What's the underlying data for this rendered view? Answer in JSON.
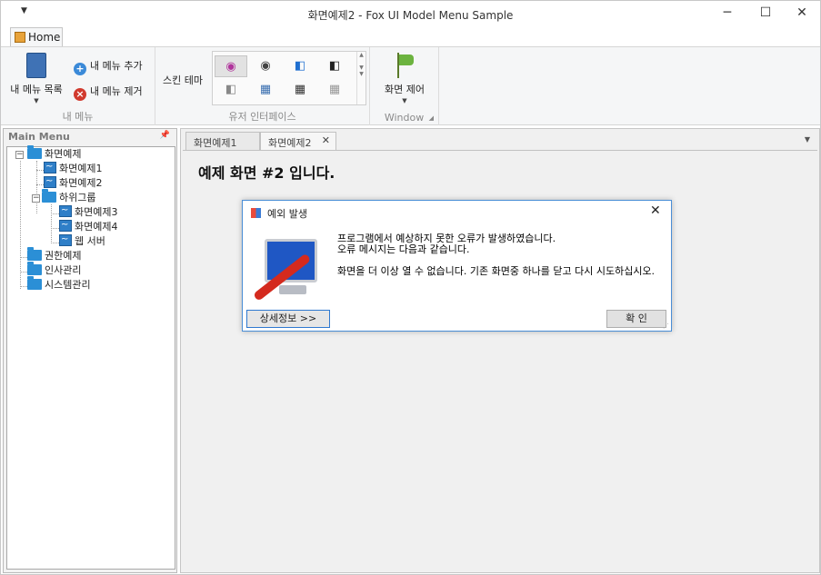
{
  "window": {
    "title": "화면예제2 - Fox UI Model Menu Sample",
    "qat_icon": "dropdown-arrow-icon",
    "min_glyph": "─",
    "max_glyph": "☐",
    "close_glyph": "✕"
  },
  "ribbon": {
    "tabs": [
      {
        "label": "Home",
        "icon": "home-icon"
      }
    ],
    "groups": {
      "my_menu": {
        "label": "내 메뉴",
        "list_button": "내 메뉴 목록",
        "add_button": "내 메뉴 추가",
        "remove_button": "내 메뉴 제거"
      },
      "ui": {
        "label": "유저 인터페이스",
        "skin_label": "스킨 테마"
      },
      "window": {
        "label": "Window",
        "control_button": "화면 제어"
      }
    }
  },
  "left_panel": {
    "title": "Main Menu",
    "tree": [
      {
        "label": "화면예제",
        "type": "folder",
        "expanded": true
      },
      {
        "label": "화면예제1",
        "type": "page"
      },
      {
        "label": "화면예제2",
        "type": "page"
      },
      {
        "label": "하위그룹",
        "type": "folder",
        "expanded": true
      },
      {
        "label": "화면예제3",
        "type": "page"
      },
      {
        "label": "화면예제4",
        "type": "page"
      },
      {
        "label": "웹 서버",
        "type": "page"
      },
      {
        "label": "권한예제",
        "type": "folder"
      },
      {
        "label": "인사관리",
        "type": "folder"
      },
      {
        "label": "시스템관리",
        "type": "folder"
      }
    ]
  },
  "documents": {
    "tabs": [
      {
        "label": "화면예제1",
        "active": false
      },
      {
        "label": "화면예제2",
        "active": true
      }
    ],
    "heading": "예제 화면 #2 입니다."
  },
  "dialog": {
    "title": "예외 발생",
    "message_line1": "프로그램에서 예상하지 못한 오류가 발생하였습니다.",
    "message_line2": "오류 메시지는 다음과 같습니다.",
    "message_line3": "화면을 더 이상 열 수 없습니다. 기존 화면중 하나를 닫고 다시 시도하십시오.",
    "detail_button": "상세정보 >>",
    "ok_button": "확 인"
  },
  "colors": {
    "accent": "#2b579a",
    "dialog_border": "#4a8ed6",
    "folder": "#2b8fd6"
  }
}
